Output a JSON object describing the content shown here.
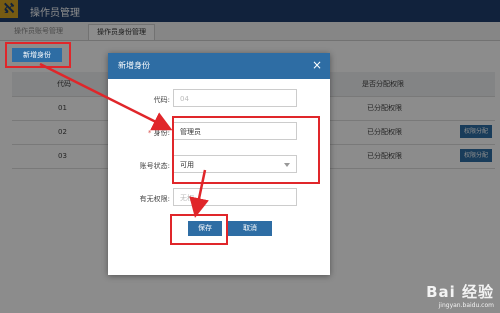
{
  "app": {
    "logo_text": "ℵ",
    "title": "操作员管理"
  },
  "tabs": [
    {
      "label": "操作员账号管理"
    },
    {
      "label": "操作员身份管理"
    }
  ],
  "toolbar": {
    "new_label": "新增身份"
  },
  "table": {
    "headers": [
      "代码",
      "是否分配权限"
    ],
    "rows": [
      {
        "code": "01",
        "assigned": "已分配权限"
      },
      {
        "code": "02",
        "assigned": "已分配权限",
        "action": "权限分配"
      },
      {
        "code": "03",
        "assigned": "已分配权限",
        "action": "权限分配"
      }
    ]
  },
  "modal": {
    "title": "新增身份",
    "close_glyph": "×",
    "fields": {
      "code_label": "代码:",
      "code_value": "04",
      "identity_label": "身份:",
      "identity_value": "管理员",
      "status_label": "账号状态:",
      "status_value": "可用",
      "perm_label": "有无权限:",
      "perm_value": "无权"
    },
    "required_mark": "*",
    "save_label": "保存",
    "cancel_label": "取消"
  },
  "watermark": {
    "main": "Bai 经验",
    "sub": "jingyan.baidu.com"
  },
  "colors": {
    "accent": "#2e6da4",
    "annotation": "#e0262a",
    "topbar": "#1f3f6e"
  }
}
